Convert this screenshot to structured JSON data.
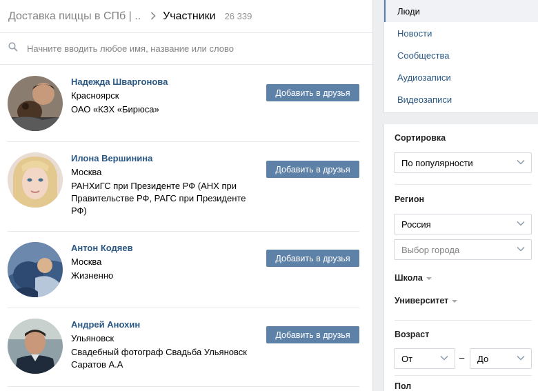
{
  "header": {
    "group_title": "Доставка пиццы в СПб | ..",
    "current": "Участники",
    "count": "26 339"
  },
  "search": {
    "placeholder": "Начните вводить любое имя, название или слово"
  },
  "members": [
    {
      "name": "Надежда Шваргонова",
      "city": "Красноярск",
      "info": [
        "ОАО «КЗХ «Бирюса»"
      ],
      "button": "Добавить в друзья"
    },
    {
      "name": "Илона Вершинина",
      "city": "Москва",
      "info": [
        "РАНХиГС при Президенте РФ (АНХ при",
        "Правительстве РФ, РАГС при Президенте",
        "РФ)"
      ],
      "button": "Добавить в друзья"
    },
    {
      "name": "Антон Кодяев",
      "city": "Москва",
      "info": [
        "Жизненно"
      ],
      "button": "Добавить в друзья"
    },
    {
      "name": "Андрей Анохин",
      "city": "Ульяновск",
      "info": [
        "Свадебный фотограф Свадьба Ульяновск",
        "Саратов А.А"
      ],
      "button": "Добавить в друзья"
    }
  ],
  "nav": {
    "items": [
      {
        "label": "Люди",
        "active": true
      },
      {
        "label": "Новости"
      },
      {
        "label": "Сообщества"
      },
      {
        "label": "Аудиозаписи"
      },
      {
        "label": "Видеозаписи"
      }
    ]
  },
  "filters": {
    "sort_label": "Сортировка",
    "sort_value": "По популярности",
    "region_label": "Регион",
    "country_value": "Россия",
    "city_placeholder": "Выбор города",
    "school_label": "Школа",
    "university_label": "Университет",
    "age_label": "Возраст",
    "age_from": "От",
    "age_dash": "–",
    "age_to": "До",
    "gender_label": "Пол"
  },
  "colors": {
    "link": "#2a5885",
    "button": "#5e81a8",
    "accent": "#5181b8"
  }
}
